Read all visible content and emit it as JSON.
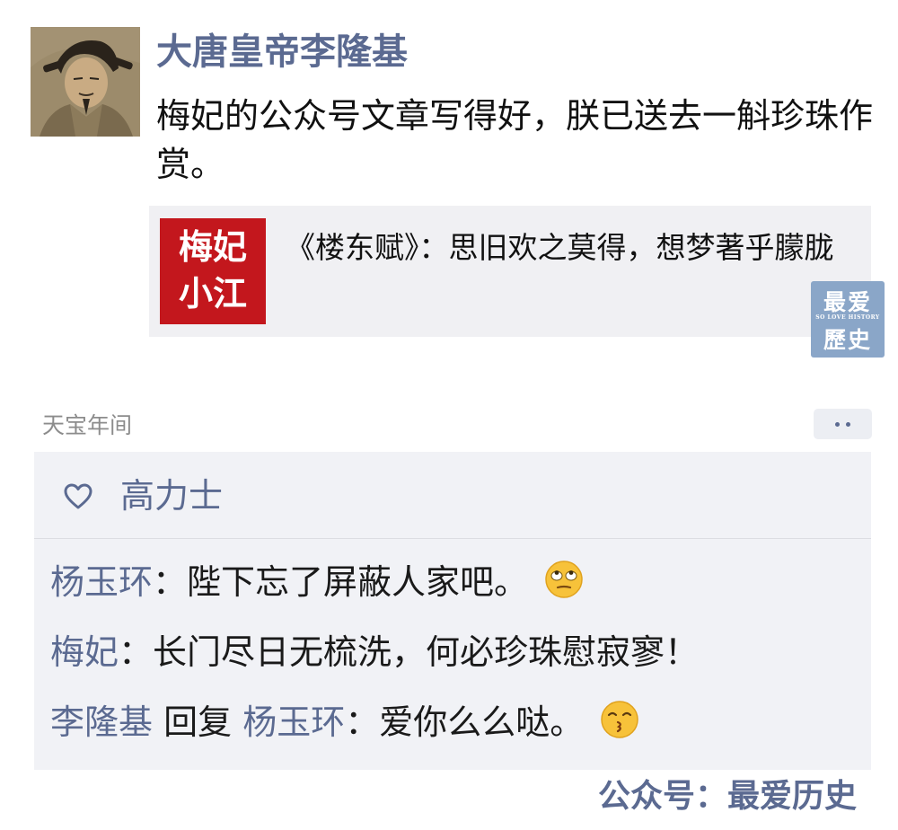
{
  "post": {
    "author": "大唐皇帝李隆基",
    "text": "梅妃的公众号文章写得好，朕已送去一斛珍珠作赏。",
    "avatar_icon": "emperor-portrait-avatar"
  },
  "link_card": {
    "thumb_line1": "梅妃",
    "thumb_line2": "小江",
    "title": "《楼东赋》：思旧欢之莫得，想梦著乎朦胧"
  },
  "watermark": {
    "top": "最爱",
    "small": "SO LOVE HISTORY",
    "bottom": "歷史"
  },
  "meta": {
    "timestamp": "天宝年间"
  },
  "likes": {
    "icon": "heart-icon",
    "names": "高力士"
  },
  "comments": [
    {
      "name": "杨玉环",
      "sep": "：",
      "text": "陛下忘了屏蔽人家吧。",
      "emoji": "rolling-eyes-emoji"
    },
    {
      "name": "梅妃",
      "sep": "：",
      "text": "长门尽日无梳洗，何必珍珠慰寂寥！"
    },
    {
      "name": "李隆基",
      "reply_word": " 回复 ",
      "reply_to": "杨玉环",
      "sep": "：",
      "text": "爱你么么哒。",
      "emoji": "kissing-emoji"
    }
  ],
  "footer": {
    "brand": "公众号：最爱历史"
  },
  "colors": {
    "name_blue": "#5b6a91",
    "thumb_red": "#c3171d",
    "card_bg": "#f0f0f3",
    "comment_bg": "#f1f2f6"
  }
}
